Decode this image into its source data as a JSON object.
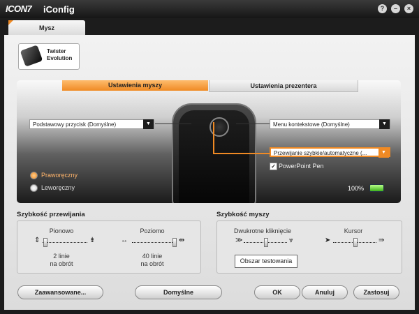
{
  "window": {
    "logo": "ICON7",
    "title": "iConfig",
    "help_glyph": "?",
    "minimize_glyph": "–",
    "close_glyph": "×"
  },
  "tabs": [
    {
      "label": "Mysz",
      "active": true
    }
  ],
  "device": {
    "name": "Twister Evolution"
  },
  "subtabs": {
    "active": "Ustawienia myszy",
    "inactive": "Ustawienia prezentera"
  },
  "buttons_map": {
    "left": "Podstawowy przycisk (Domyślne)",
    "right_top": "Menu kontekstowe (Domyślne)",
    "scroll": "Przewijanie szybkie/automatyczne (..."
  },
  "hand": {
    "options": [
      {
        "label": "Praworęczny",
        "selected": true
      },
      {
        "label": "Leworęczny",
        "selected": false
      }
    ]
  },
  "powerpoint_pen": {
    "label": "PowerPoint Pen",
    "checked": true
  },
  "battery": {
    "level_text": "100%",
    "level": 1.0,
    "color": "#3fb21a"
  },
  "scroll_speed": {
    "title": "Szybkość przewijania",
    "vertical": {
      "label": "Pionowo",
      "value_line1": "2 linie",
      "value_line2": "na obrót",
      "position": 0.1
    },
    "horizontal": {
      "label": "Poziomo",
      "value_line1": "40 linie",
      "value_line2": "na obrót",
      "position": 0.95
    }
  },
  "mouse_speed": {
    "title": "Szybkość myszy",
    "double_click": {
      "label": "Dwukrotne kliknięcie",
      "position": 0.5
    },
    "cursor": {
      "label": "Kursor",
      "position": 0.5
    },
    "test_button": "Obszar testowania"
  },
  "footer": {
    "advanced": "Zaawansowane...",
    "defaults": "Domyślne",
    "ok": "OK",
    "cancel": "Anuluj",
    "apply": "Zastosuj"
  },
  "colors": {
    "accent": "#f08a24",
    "background": "#1c1c1c"
  }
}
